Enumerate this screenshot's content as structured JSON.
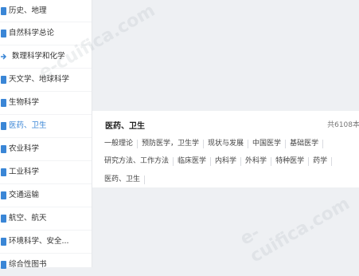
{
  "sidebar": {
    "items": [
      {
        "label": "历史、地理",
        "icon": "book-icon"
      },
      {
        "label": "自然科学总论",
        "icon": "book-icon"
      },
      {
        "label": "数理科学和化学",
        "icon": "arrow-icon"
      },
      {
        "label": "天文学、地球科学",
        "icon": "book-icon"
      },
      {
        "label": "生物科学",
        "icon": "book-icon"
      },
      {
        "label": "医药、卫生",
        "icon": "book-icon"
      },
      {
        "label": "农业科学",
        "icon": "book-icon"
      },
      {
        "label": "工业科学",
        "icon": "book-icon"
      },
      {
        "label": "交通运输",
        "icon": "book-icon"
      },
      {
        "label": "航空、航天",
        "icon": "book-icon"
      },
      {
        "label": "环境科学、安全...",
        "icon": "book-icon"
      },
      {
        "label": "综合性图书",
        "icon": "book-icon"
      }
    ],
    "active_index": 5,
    "accent_color": "#3a86d6"
  },
  "detail": {
    "title": "医药、卫生",
    "count": "共6108本",
    "rows": [
      [
        "一般理论",
        "预防医学，卫生学",
        "现状与发展",
        "中国医学",
        "基础医学"
      ],
      [
        "研究方法、工作方法",
        "临床医学",
        "内科学",
        "外科学",
        "特种医学",
        "药学"
      ],
      [
        "医药、卫生"
      ]
    ]
  },
  "watermark": {
    "text": "e-cuifica.com"
  }
}
